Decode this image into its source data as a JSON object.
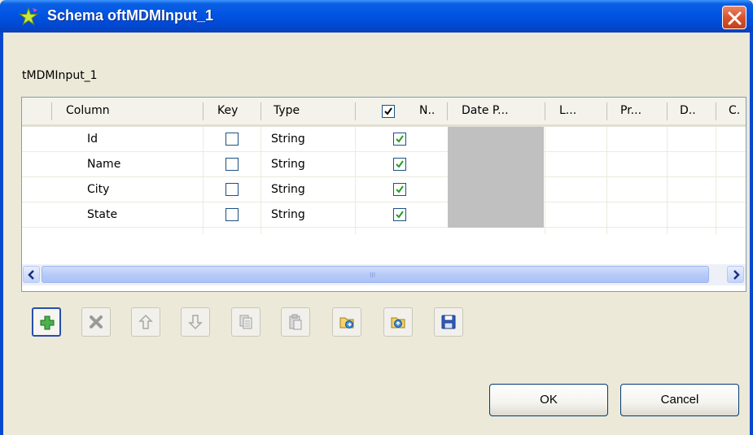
{
  "window": {
    "title": "Schema oftMDMInput_1",
    "icon": "talend-star-icon",
    "close_icon": "close-icon"
  },
  "component_label": "tMDMInput_1",
  "table": {
    "headers": [
      "Column",
      "Key",
      "Type",
      "N..",
      "Date P...",
      "L...",
      "Pr...",
      "D..",
      "C."
    ],
    "nullable_header_checked": true,
    "rows": [
      {
        "column": "Id",
        "key": false,
        "type": "String",
        "nullable": true
      },
      {
        "column": "Name",
        "key": false,
        "type": "String",
        "nullable": true
      },
      {
        "column": "City",
        "key": false,
        "type": "String",
        "nullable": true
      },
      {
        "column": "State",
        "key": false,
        "type": "String",
        "nullable": true
      }
    ],
    "scrollbar_grip": "III"
  },
  "toolbar": [
    {
      "name": "add-button",
      "icon": "plus-icon",
      "enabled": true
    },
    {
      "name": "remove-button",
      "icon": "x-icon",
      "enabled": false
    },
    {
      "name": "move-up-button",
      "icon": "arrow-up-icon",
      "enabled": false
    },
    {
      "name": "move-down-button",
      "icon": "arrow-down-icon",
      "enabled": false
    },
    {
      "name": "copy-button",
      "icon": "copy-icon",
      "enabled": false
    },
    {
      "name": "paste-button",
      "icon": "paste-icon",
      "enabled": false
    },
    {
      "name": "import-button",
      "icon": "import-icon",
      "enabled": true
    },
    {
      "name": "export-button",
      "icon": "export-icon",
      "enabled": true
    },
    {
      "name": "save-button",
      "icon": "disk-icon",
      "enabled": true
    }
  ],
  "buttons": {
    "ok": "OK",
    "cancel": "Cancel"
  },
  "colors": {
    "titlebar": "#0054e3",
    "dialog_bg": "#ece9d8",
    "check_green": "#21a121"
  }
}
